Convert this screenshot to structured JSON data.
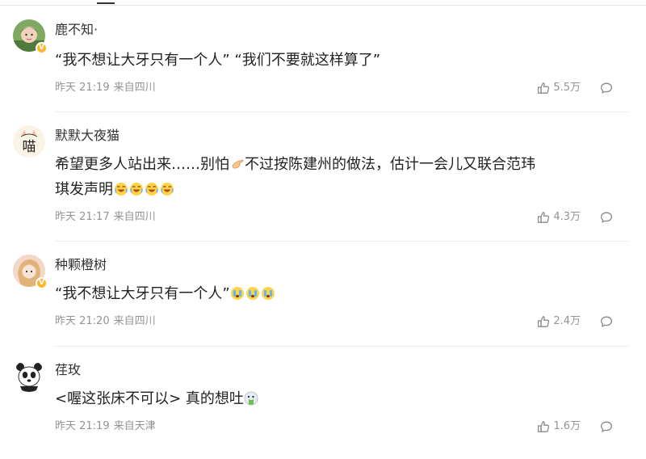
{
  "comments": [
    {
      "username": "鹿不知·",
      "verified": true,
      "text_parts": [
        "“我不想让大牙只有一个人” “我们不要就这样算了”"
      ],
      "time": "昨天 21:19",
      "location": "来自四川",
      "likes": "5.5万"
    },
    {
      "username": "默默大夜猫",
      "verified": false,
      "text_parts": [
        "希望更多人站出来……别怕",
        "不过按陈建州的做法，估计一会儿又联合范玮",
        "琪发声明"
      ],
      "time": "昨天 21:17",
      "location": "来自四川",
      "likes": "4.3万"
    },
    {
      "username": "种颗橙树",
      "verified": true,
      "text_parts": [
        "“我不想让大牙只有一个人”"
      ],
      "time": "昨天 21:20",
      "location": "来自四川",
      "likes": "2.4万"
    },
    {
      "username": "荏玫",
      "verified": false,
      "text_parts": [
        "<喔这张床不可以> 真的想吐"
      ],
      "time": "昨天 21:19",
      "location": "来自天津",
      "likes": "1.6万"
    }
  ],
  "icons": {
    "like": "thumbs-up-icon",
    "reply": "comment-bubble-icon",
    "verified": "verified-badge-icon"
  },
  "colors": {
    "meta_text": "#939393",
    "verified_badge": "#ffb52b",
    "divider": "#ececec"
  }
}
